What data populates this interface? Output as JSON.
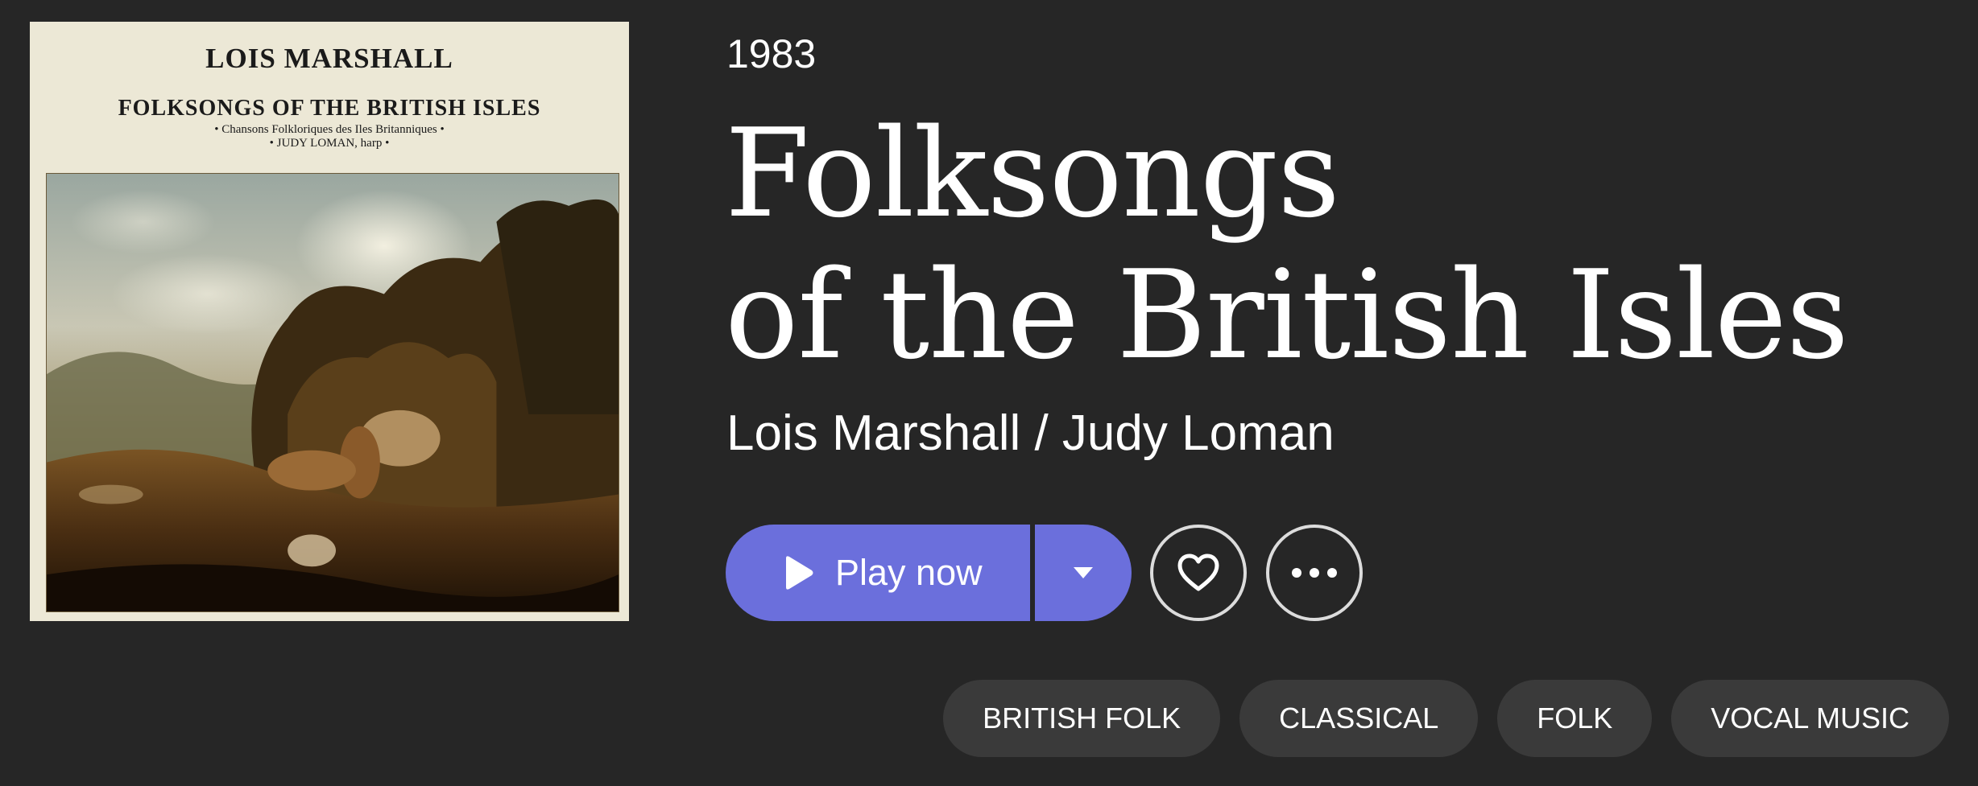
{
  "cover": {
    "artist": "LOIS MARSHALL",
    "title": "FOLKSONGS OF THE BRITISH ISLES",
    "subtitle": "• Chansons Folkloriques des Iles Britanniques •",
    "performer": "• JUDY LOMAN, harp •",
    "painting_icon": "landscape-painting"
  },
  "album": {
    "year": "1983",
    "title_line1": "Folksongs",
    "title_line2": "of the British Isles",
    "artists": "Lois Marshall / Judy Loman"
  },
  "actions": {
    "play_label": "Play now",
    "play_icon": "play-icon",
    "dropdown_icon": "caret-down-icon",
    "favorite_icon": "heart-icon",
    "more_icon": "ellipsis-icon",
    "accent_color": "#6b6fdc"
  },
  "tags": [
    "BRITISH FOLK",
    "CLASSICAL",
    "FOLK",
    "VOCAL MUSIC"
  ]
}
